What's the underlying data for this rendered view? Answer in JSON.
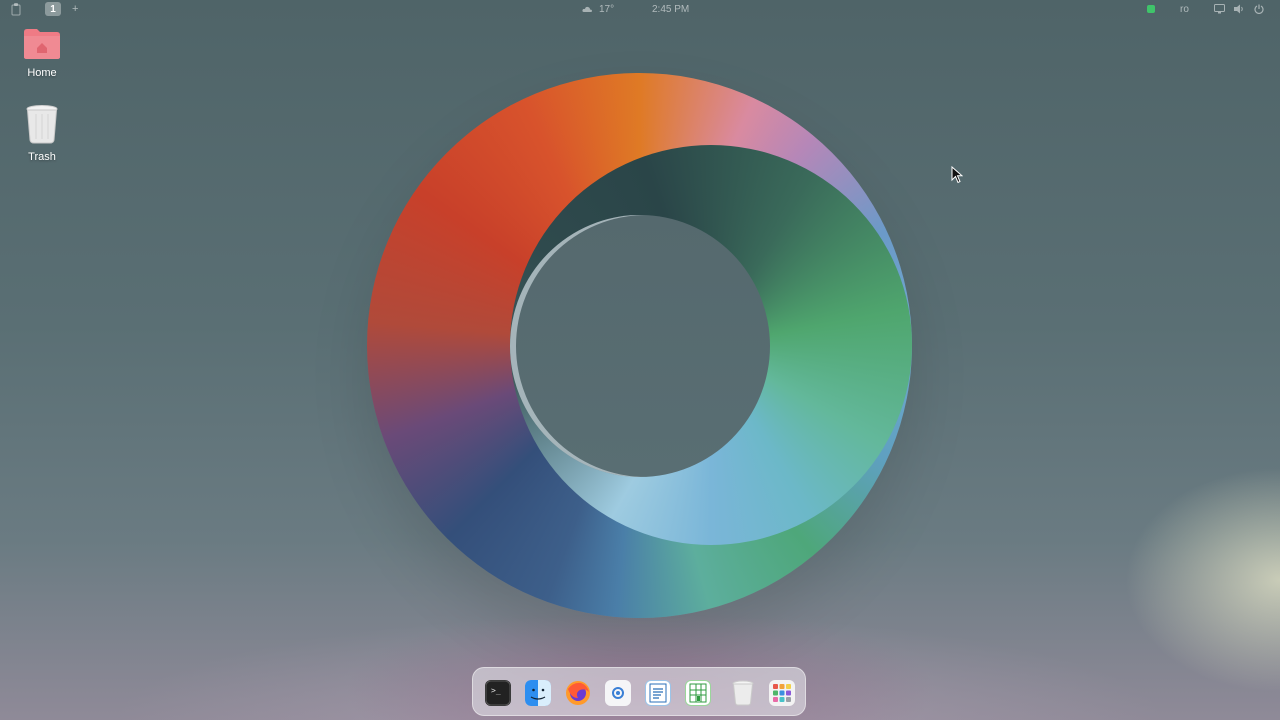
{
  "top_bar": {
    "apps_icon": "apps-grid-icon",
    "workspace_number": "1",
    "add_workspace": "+",
    "weather_icon": "cloud-night-icon",
    "temperature": "17°",
    "time": "2:45 PM",
    "indicator_icon": "green-status-icon",
    "keyboard_layout": "ro",
    "tray_icons": [
      "display-icon",
      "volume-icon",
      "power-icon"
    ]
  },
  "desktop": {
    "icons": [
      {
        "label": "Home",
        "icon": "home-folder-icon"
      },
      {
        "label": "Trash",
        "icon": "trash-icon"
      }
    ]
  },
  "dock": {
    "apps": [
      {
        "name": "Terminal",
        "icon": "terminal-icon"
      },
      {
        "name": "Finder",
        "icon": "finder-icon"
      },
      {
        "name": "Firefox",
        "icon": "firefox-icon"
      },
      {
        "name": "Settings",
        "icon": "settings-icon"
      },
      {
        "name": "Writer",
        "icon": "writer-document-icon"
      },
      {
        "name": "Calc",
        "icon": "calc-spreadsheet-icon"
      },
      {
        "name": "Trash",
        "icon": "trash-icon"
      },
      {
        "name": "App Grid",
        "icon": "app-grid-icon"
      }
    ]
  },
  "colors": {
    "accent_green": "#3fc46a",
    "folder_pink": "#ef7b85"
  }
}
